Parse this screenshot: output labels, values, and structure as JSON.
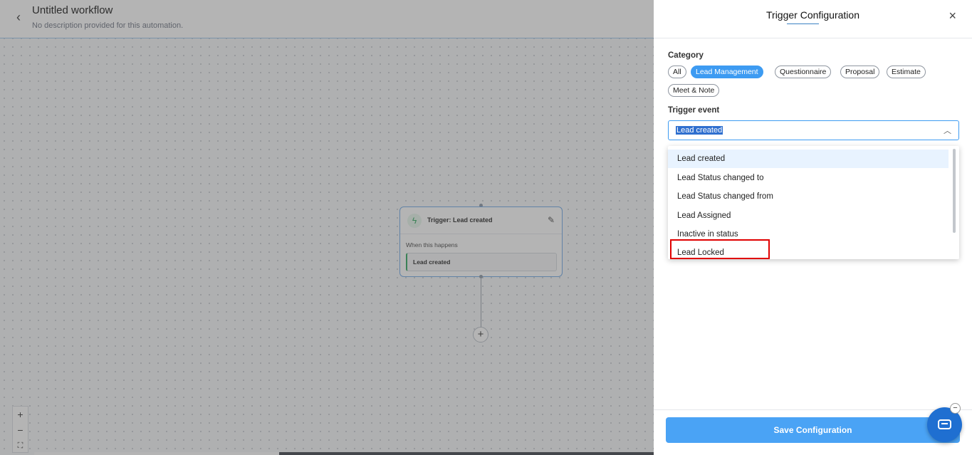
{
  "workflow": {
    "title": "Untitled workflow",
    "description": "No description provided for this automation."
  },
  "node": {
    "title": "Trigger: Lead created",
    "subtitle": "When this happens",
    "value": "Lead created"
  },
  "zoom": {
    "in": "+",
    "out": "−",
    "fit": "⛶"
  },
  "panel": {
    "title": "Trigger Configuration",
    "close_icon": "×",
    "category_label": "Category",
    "categories": [
      "All",
      "Lead Management",
      "Questionnaire",
      "Proposal",
      "Estimate",
      "Meet & Note"
    ],
    "active_category": "Lead Management",
    "trigger_label": "Trigger event",
    "selected_trigger": "Lead created",
    "options": [
      "Lead created",
      "Lead Status changed to",
      "Lead Status changed from",
      "Lead Assigned",
      "Inactive in status",
      "Lead Locked"
    ],
    "save_label": "Save Configuration"
  },
  "colors": {
    "accent": "#3d9bf2",
    "highlight_box": "#e00000",
    "node_status": "#2aa55a"
  }
}
